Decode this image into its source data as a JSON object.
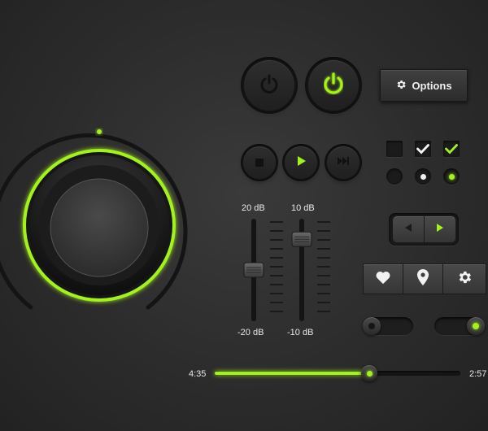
{
  "accent": "#a4f21a",
  "power": {
    "off_icon": "power-icon",
    "on_icon": "power-icon"
  },
  "options_button": {
    "label": "Options",
    "icon": "gear-icon"
  },
  "transport": {
    "stop_icon": "stop-icon",
    "play_icon": "play-icon",
    "next_icon": "skip-forward-icon"
  },
  "checkboxes": [
    {
      "checked": false
    },
    {
      "checked": true
    },
    {
      "checked": true,
      "accent": true
    }
  ],
  "radios": [
    {
      "selected": false
    },
    {
      "selected": true
    },
    {
      "selected": true,
      "accent": true
    }
  ],
  "knob": {
    "level": 1.0
  },
  "faders": [
    {
      "top_label": "20 dB",
      "bottom_label": "-20 dB",
      "level": 0.5
    },
    {
      "top_label": "10 dB",
      "bottom_label": "-10 dB",
      "level": 0.82
    }
  ],
  "pager": {
    "prev_icon": "arrow-left-icon",
    "next_icon": "arrow-right-icon"
  },
  "icon_bar": [
    "heart-icon",
    "map-pin-icon",
    "gear-icon"
  ],
  "toggles": [
    {
      "on": false
    },
    {
      "on": true
    }
  ],
  "progress": {
    "elapsed": "4:35",
    "remaining": "2:57",
    "fraction": 0.63
  }
}
